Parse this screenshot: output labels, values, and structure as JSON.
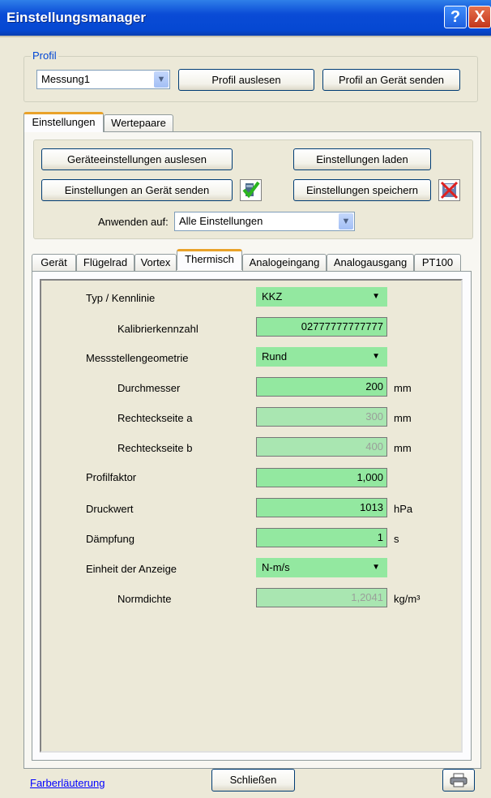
{
  "window": {
    "title": "Einstellungsmanager",
    "help_glyph": "?",
    "close_glyph": "X"
  },
  "profil": {
    "legend": "Profil",
    "selected": "Messung1",
    "read_button": "Profil auslesen",
    "send_button": "Profil an Gerät senden"
  },
  "tabs": [
    {
      "label": "Einstellungen",
      "active": true
    },
    {
      "label": "Wertepaare",
      "active": false
    }
  ],
  "actions": {
    "read_device": "Geräteeinstellungen auslesen",
    "load": "Einstellungen laden",
    "send_device": "Einstellungen an Gerät senden",
    "save": "Einstellungen speichern",
    "apply_label": "Anwenden auf:",
    "apply_value": "Alle Einstellungen"
  },
  "subtabs": [
    {
      "label": "Gerät",
      "active": false
    },
    {
      "label": "Flügelrad",
      "active": false
    },
    {
      "label": "Vortex",
      "active": false
    },
    {
      "label": "Thermisch",
      "active": true
    },
    {
      "label": "Analogeingang",
      "active": false
    },
    {
      "label": "Analogausgang",
      "active": false
    },
    {
      "label": "PT100",
      "active": false
    }
  ],
  "settings": {
    "typ_label": "Typ / Kennlinie",
    "typ_value": "KKZ",
    "kalib_label": "Kalibrierkennzahl",
    "kalib_value": "02777777777777",
    "geom_label": "Messstellengeometrie",
    "geom_value": "Rund",
    "durch_label": "Durchmesser",
    "durch_value": "200",
    "durch_unit": "mm",
    "recht_a_label": "Rechteckseite a",
    "recht_a_value": "300",
    "recht_a_unit": "mm",
    "recht_b_label": "Rechteckseite b",
    "recht_b_value": "400",
    "recht_b_unit": "mm",
    "profil_label": "Profilfaktor",
    "profil_value": "1,000",
    "druck_label": "Druckwert",
    "druck_value": "1013",
    "druck_unit": "hPa",
    "daempf_label": "Dämpfung",
    "daempf_value": "1",
    "daempf_unit": "s",
    "einheit_label": "Einheit der Anzeige",
    "einheit_value": "N-m/s",
    "normd_label": "Normdichte",
    "normd_value": "1,2041",
    "normd_unit": "kg/m³"
  },
  "footer": {
    "link": "Farberläuterung",
    "close_button": "Schließen"
  },
  "colors": {
    "field_green": "#93e8a0",
    "active_tab_accent": "#e9a22a",
    "title_blue": "#0548d2"
  }
}
